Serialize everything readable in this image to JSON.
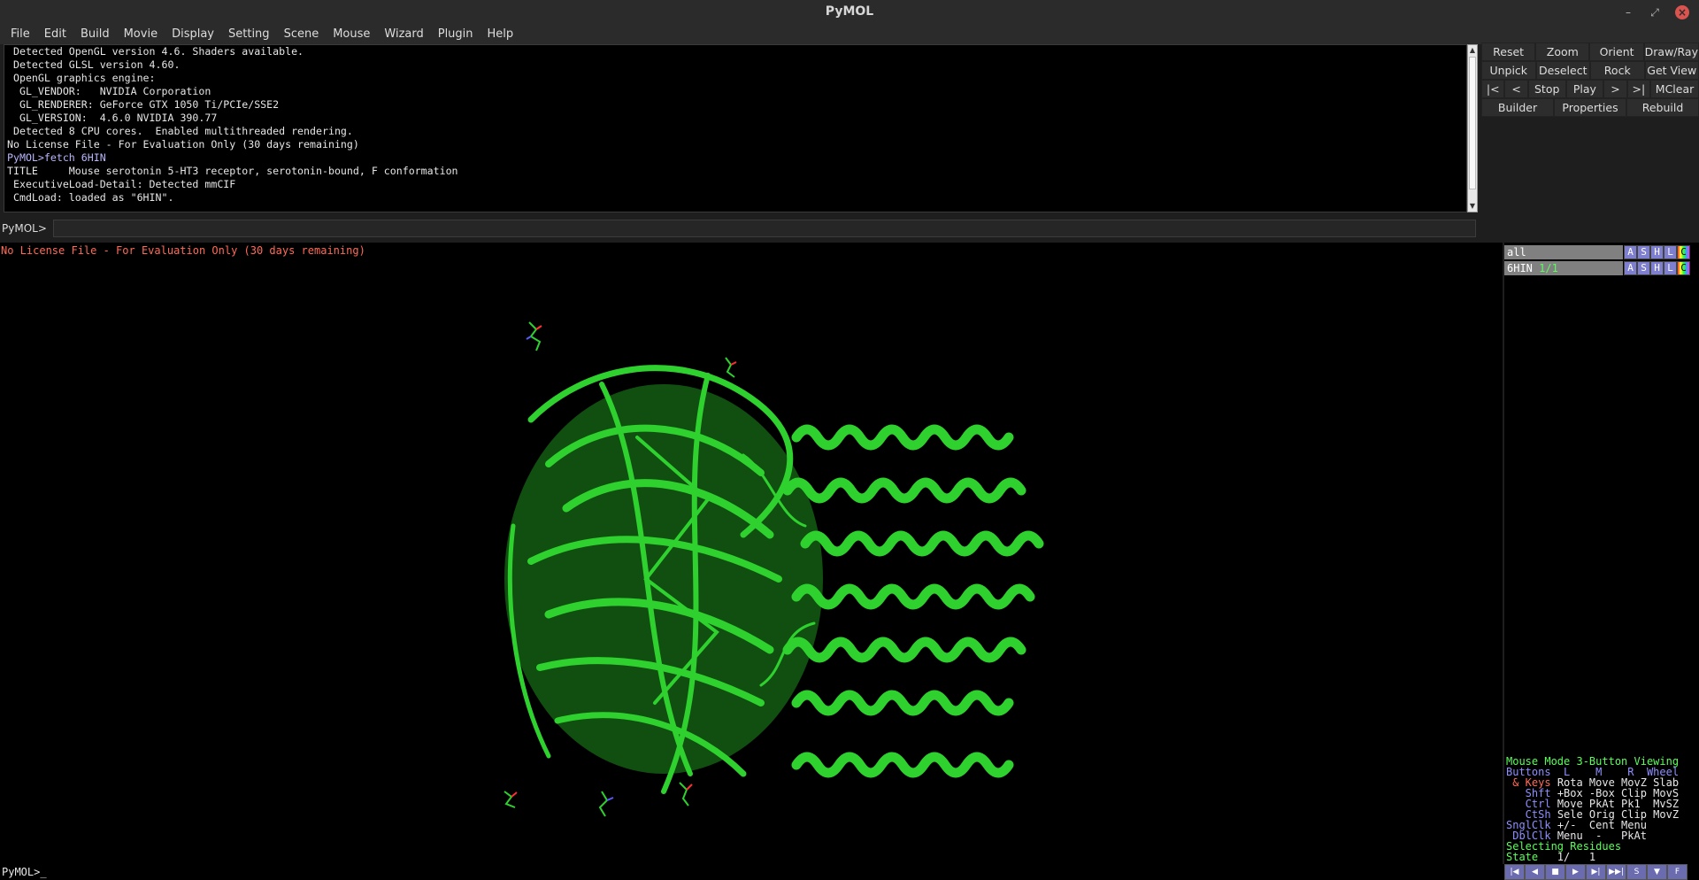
{
  "window": {
    "title": "PyMOL"
  },
  "menu": [
    "File",
    "Edit",
    "Build",
    "Movie",
    "Display",
    "Setting",
    "Scene",
    "Mouse",
    "Wizard",
    "Plugin",
    "Help"
  ],
  "console": {
    "lines": [
      " Detected OpenGL version 4.6. Shaders available.",
      " Detected GLSL version 4.60.",
      " OpenGL graphics engine:",
      "  GL_VENDOR:   NVIDIA Corporation",
      "  GL_RENDERER: GeForce GTX 1050 Ti/PCIe/SSE2",
      "  GL_VERSION:  4.6.0 NVIDIA 390.77",
      " Detected 8 CPU cores.  Enabled multithreaded rendering.",
      "No License File - For Evaluation Only (30 days remaining)",
      "PyMOL>fetch 6HIN",
      "TITLE     Mouse serotonin 5-HT3 receptor, serotonin-bound, F conformation",
      " ExecutiveLoad-Detail: Detected mmCIF",
      " CmdLoad: loaded as \"6HIN\"."
    ]
  },
  "command": {
    "prompt": "PyMOL>",
    "value": ""
  },
  "buttons": {
    "row1": [
      "Reset",
      "Zoom",
      "Orient",
      "Draw/Ray"
    ],
    "row2": [
      "Unpick",
      "Deselect",
      "Rock",
      "Get View"
    ],
    "row3": [
      "|<",
      "<",
      "Stop",
      "Play",
      ">",
      ">|",
      "MClear"
    ],
    "row4": [
      "Builder",
      "Properties",
      "Rebuild"
    ]
  },
  "viewport": {
    "license_text": "No License File - For Evaluation Only (30 days remaining)"
  },
  "objects": [
    {
      "name": "all",
      "state": ""
    },
    {
      "name": "6HIN",
      "state": "1/1"
    }
  ],
  "object_buttons": [
    "A",
    "S",
    "H",
    "L",
    "C"
  ],
  "mouse_panel": {
    "title": "Mouse Mode 3-Button Viewing",
    "header": "Buttons  L    M    R  Wheel",
    "rows": [
      {
        "key": " & Keys",
        "vals": "Rota Move MovZ Slab"
      },
      {
        "key": "   Shft",
        "vals": "+Box -Box Clip MovS"
      },
      {
        "key": "   Ctrl",
        "vals": "Move PkAt Pk1  MvSZ"
      },
      {
        "key": "   CtSh",
        "vals": "Sele Orig Clip MovZ"
      },
      {
        "key": "SnglClk",
        "vals": "+/-  Cent Menu"
      },
      {
        "key": " DblClk",
        "vals": "Menu  -   PkAt"
      }
    ],
    "selecting": "Selecting Residues",
    "state_label": "State",
    "state_value": "   1/   1"
  },
  "bottom": {
    "prompt": "PyMOL>_"
  },
  "movie_controls": [
    "|◀",
    "◀",
    "■",
    "▶",
    "▶|",
    "▶▶|",
    "S",
    "▼",
    "F"
  ],
  "colors": {
    "protein": "#2fd12f",
    "license": "#ff6a57",
    "command_echo": "#b9b6ff"
  }
}
